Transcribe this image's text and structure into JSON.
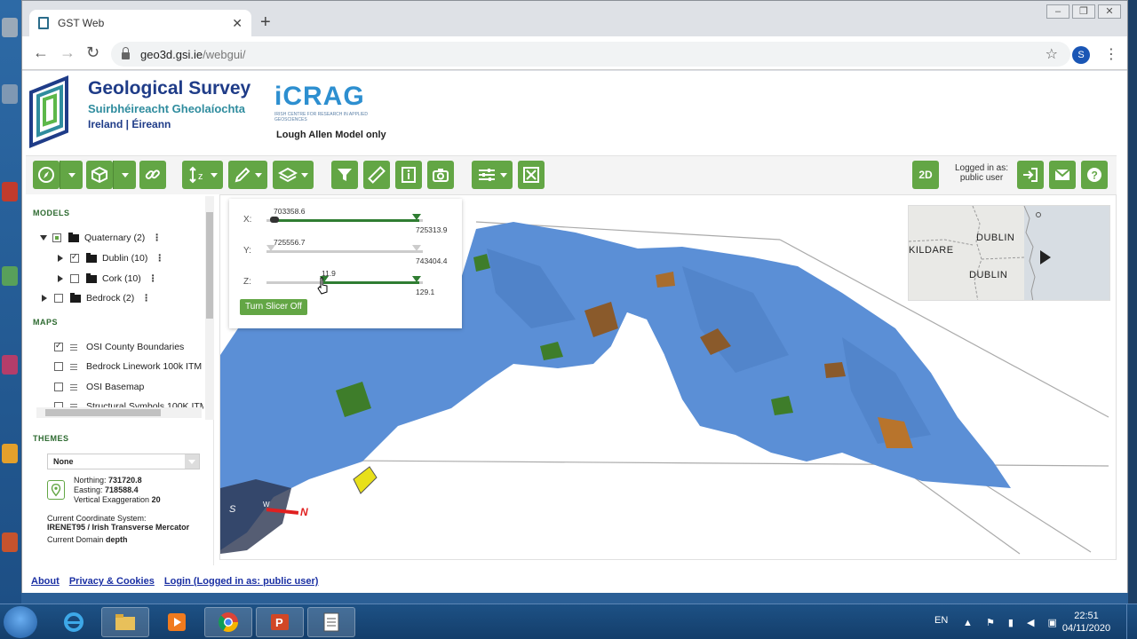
{
  "browser": {
    "tab_title": "GST Web",
    "url_host": "geo3d.gsi.ie",
    "url_path": "/webgui/",
    "profile_initial": "S"
  },
  "header": {
    "gsi_title": "Geological Survey",
    "gsi_sub_irish": "Suirbhéireacht Gheolaíochta",
    "gsi_sub_country": "Ireland  |  Éireann",
    "icrag_logo": "iCRAG",
    "icrag_small": "IRISH CENTRE FOR RESEARCH IN APPLIED GEOSCIENCES",
    "model_caption": "Lough Allen Model only"
  },
  "toolbar": {
    "logged_in_label": "Logged in as:",
    "logged_in_user": "public user",
    "mode_2d_label": "2D",
    "z_label": "z"
  },
  "sidebar": {
    "models_heading": "MODELS",
    "models": [
      {
        "label": "Quaternary (2)",
        "state": "partial",
        "expanded": true
      },
      {
        "label": "Dublin (10)",
        "state": "checked",
        "expanded": false
      },
      {
        "label": "Cork (10)",
        "state": "unchecked",
        "expanded": false
      },
      {
        "label": "Bedrock (2)",
        "state": "unchecked",
        "expanded": false
      }
    ],
    "maps_heading": "MAPS",
    "maps": [
      {
        "label": "OSI County Boundaries",
        "checked": true
      },
      {
        "label": "Bedrock Linework 100k ITM",
        "checked": false
      },
      {
        "label": "OSI Basemap",
        "checked": false
      },
      {
        "label": "Structural Symbols 100K ITM",
        "checked": false
      }
    ],
    "themes_heading": "THEMES",
    "themes_value": "None",
    "northing_label": "Northing:",
    "northing_value": "731720.8",
    "easting_label": "Easting:",
    "easting_value": "718588.4",
    "vexag_label": "Vertical Exaggeration",
    "vexag_value": "20",
    "crs_label": "Current Coordinate System:",
    "crs_value": "IRENET95 / Irish Transverse Mercator",
    "domain_label": "Current Domain",
    "domain_value": "depth"
  },
  "slicer": {
    "x_label": "X:",
    "x_min": "703358.6",
    "x_max": "725313.9",
    "y_label": "Y:",
    "y_min": "725556.7",
    "y_max": "743404.4",
    "z_label": "Z:",
    "z_min": "11.9",
    "z_max": "129.1",
    "button_label": "Turn Slicer Off"
  },
  "minimap": {
    "labels": [
      "KILDARE",
      "DUBLIN",
      "DUBLIN"
    ]
  },
  "compass": {
    "north_label": "N",
    "south_label": "S",
    "west_label": "W"
  },
  "footer": {
    "about": "About",
    "privacy": "Privacy & Cookies",
    "login": "Login (Logged in as: public user)"
  },
  "taskbar": {
    "language": "EN",
    "time": "22:51",
    "date": "04/11/2020"
  },
  "colors": {
    "accent_green": "#63a645",
    "model_blue": "#5b8fd6",
    "link_blue": "#1a2fa3"
  }
}
